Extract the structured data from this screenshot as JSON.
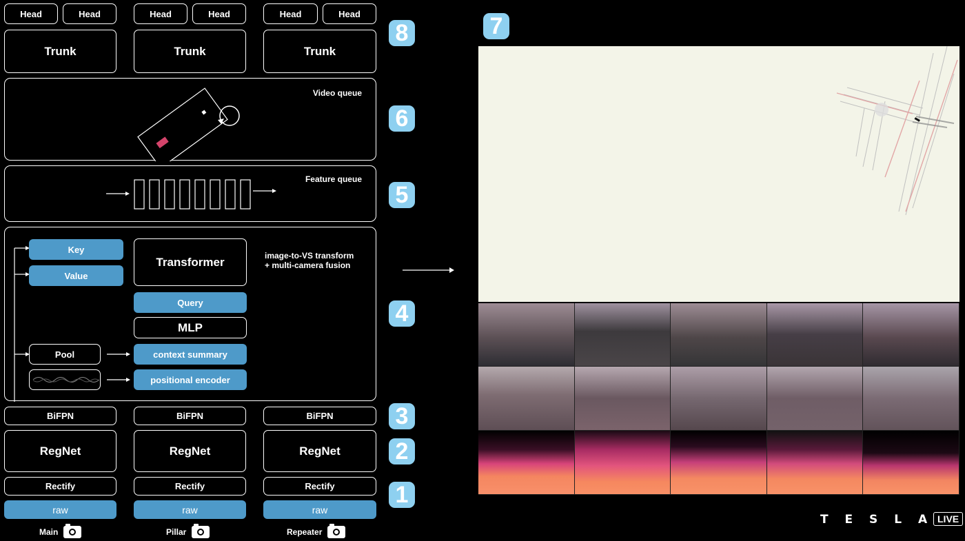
{
  "row_heads": [
    "Head",
    "Head",
    "Head",
    "Head",
    "Head",
    "Head"
  ],
  "trunks": [
    "Trunk",
    "Trunk",
    "Trunk"
  ],
  "video_queue_label": "Video queue",
  "feature_queue_label": "Feature queue",
  "fusion": {
    "key": "Key",
    "value": "Value",
    "transformer": "Transformer",
    "description_line1": "image-to-VS transform",
    "description_line2": "+ multi-camera fusion",
    "query": "Query",
    "mlp": "MLP",
    "pool": "Pool",
    "context_summary": "context summary",
    "positional_encoder": "positional encoder"
  },
  "bifpn": [
    "BiFPN",
    "BiFPN",
    "BiFPN"
  ],
  "regnet": [
    "RegNet",
    "RegNet",
    "RegNet"
  ],
  "rectify": [
    "Rectify",
    "Rectify",
    "Rectify"
  ],
  "raw": [
    "raw",
    "raw",
    "raw"
  ],
  "cameras": [
    "Main",
    "Pillar",
    "Repeater"
  ],
  "step_numbers": [
    "8",
    "6",
    "5",
    "4",
    "3",
    "2",
    "1",
    "7"
  ],
  "brand": {
    "wordmark": "T E S L A",
    "badge": "LIVE"
  },
  "colors": {
    "accent_blue": "#4e9ac9",
    "number_badge": "#8ed0f0",
    "map_bg": "#f3f4e8"
  }
}
